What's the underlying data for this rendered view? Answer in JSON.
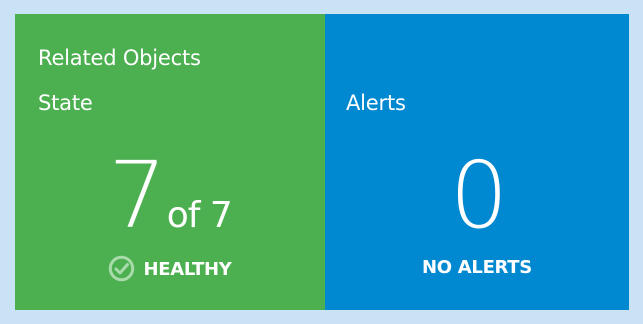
{
  "tiles": {
    "related": {
      "title_line1": "Related Objects",
      "title_line2": "State",
      "count": "7",
      "of_text": "of 7",
      "status": "HEALTHY",
      "status_icon": "check-circle-icon",
      "color": "#4caf50"
    },
    "alerts": {
      "title": "Alerts",
      "count": "0",
      "status": "NO ALERTS",
      "color": "#0088d1"
    }
  },
  "colors": {
    "background": "#c9e2f6",
    "text": "#ffffff"
  }
}
